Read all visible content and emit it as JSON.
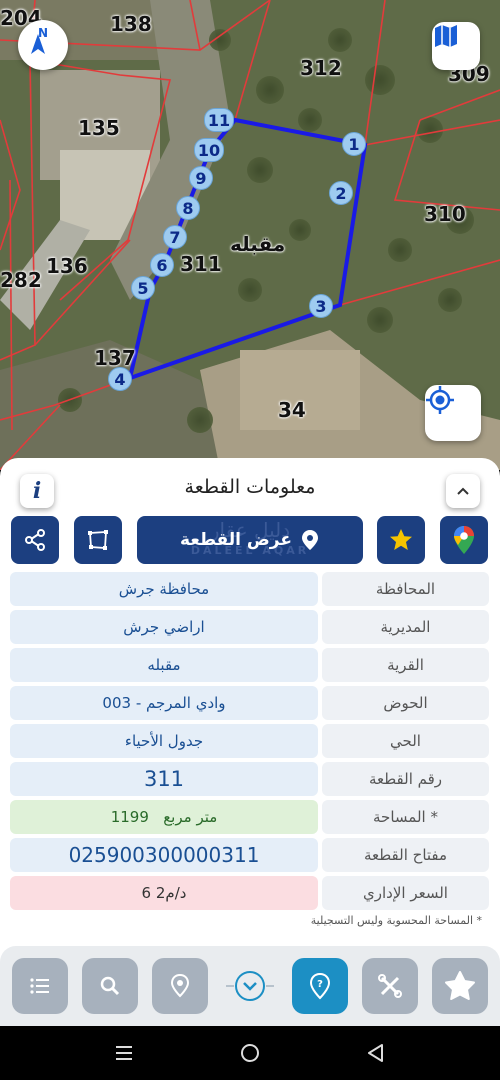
{
  "map": {
    "parcel_labels": [
      "204",
      "138",
      "312",
      "309",
      "135",
      "310",
      "282",
      "136",
      "311",
      "137",
      "34"
    ],
    "village_label": "مقبله",
    "vertex_labels": [
      "1",
      "2",
      "3",
      "4",
      "5",
      "6",
      "7",
      "8",
      "9",
      "10",
      "11"
    ],
    "compass_letter": "N",
    "colors": {
      "boundary": "#1a1ae6",
      "parcel_lines": "#e23b3b",
      "vertex_bg": "#9ecbf0"
    }
  },
  "panel": {
    "title": "معلومات القطعة",
    "show_parcel_label": "عرض القطعة",
    "watermark_text": "دليل عقار",
    "watermark_latin": "DALEEL AQAR",
    "rows": [
      {
        "label": "المحافظة",
        "value": "محافظة جرش"
      },
      {
        "label": "المديرية",
        "value": "اراضي جرش"
      },
      {
        "label": "القرية",
        "value": "مقبله"
      },
      {
        "label": "الحوض",
        "value": "وادي المرجم - 003"
      },
      {
        "label": "الحي",
        "value": "جدول الأحياء"
      },
      {
        "label": "رقم القطعة",
        "value": "311"
      },
      {
        "label": "المساحة *",
        "value": "1199   متر مربع"
      },
      {
        "label": "مفتاح القطعة",
        "value": "025900300000311"
      },
      {
        "label": "السعر الإداري",
        "value": "6 د/م2"
      }
    ],
    "footnote": "* المساحة المحسوبة وليس التسجيلية"
  },
  "icons": {
    "compass": "compass-north-icon",
    "map_layers": "map-icon",
    "locate": "crosshair-icon",
    "info": "info-icon",
    "collapse": "chevron-up-icon",
    "share": "share-icon",
    "polygon": "polygon-icon",
    "pin": "pin-icon",
    "star": "star-icon",
    "google_maps": "google-maps-icon",
    "list": "list-icon",
    "search": "search-icon",
    "location": "location-icon",
    "chevron_down": "chevron-down-icon",
    "help": "help-pin-icon",
    "tools": "tools-icon",
    "shape": "star-shape-icon"
  }
}
